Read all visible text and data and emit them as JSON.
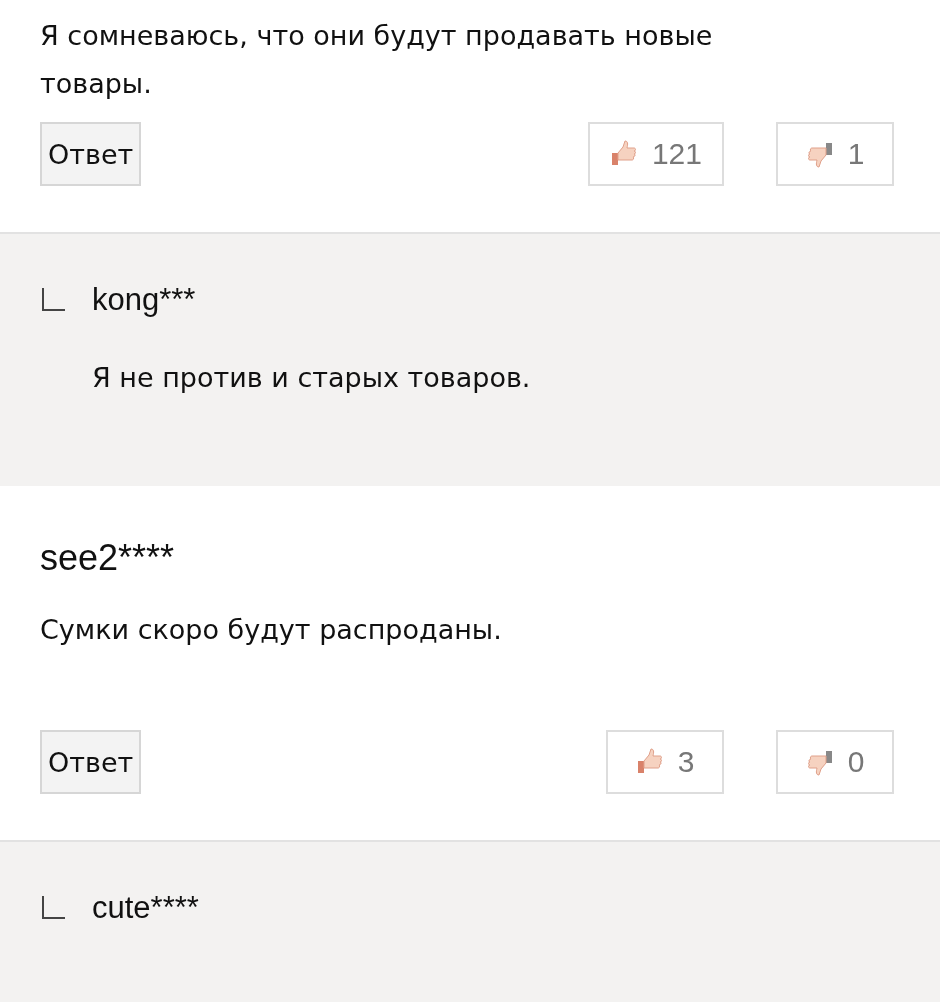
{
  "items": [
    {
      "kind": "comment",
      "text": "Я сомневаюсь, что они будут продавать новые товары.",
      "reply_label": "Ответ",
      "likes": "121",
      "dislikes": "1"
    },
    {
      "kind": "reply",
      "author": "kong***",
      "text": "Я не против и старых товаров."
    },
    {
      "kind": "comment",
      "author": "see2****",
      "text": "Сумки скоро будут распроданы.",
      "reply_label": "Ответ",
      "likes": "3",
      "dislikes": "0"
    },
    {
      "kind": "reply",
      "author": "cute****"
    }
  ]
}
